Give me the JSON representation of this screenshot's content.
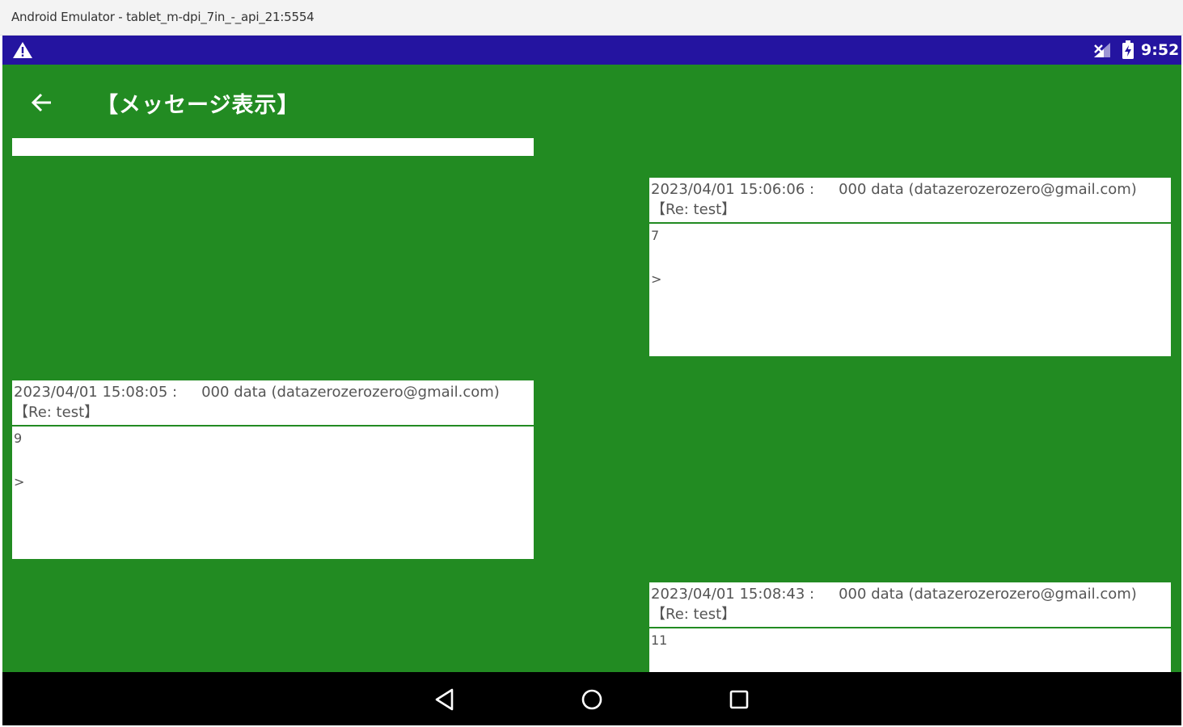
{
  "window": {
    "title": "Android Emulator - tablet_m-dpi_7in_-_api_21:5554"
  },
  "status_bar": {
    "time": "9:52",
    "background": "#2414a0"
  },
  "app_bar": {
    "title": "【メッセージ表示】",
    "background": "#228b22"
  },
  "search": {
    "value": "",
    "placeholder": ""
  },
  "messages": [
    {
      "timestamp": "2023/04/01 15:06:06 :",
      "sender": "000 data (datazerozerozero@gmail.com)",
      "subject": "【Re: test】",
      "body": "7",
      "quote": ">"
    },
    {
      "timestamp": "2023/04/01 15:08:05 :",
      "sender": "000 data (datazerozerozero@gmail.com)",
      "subject": "【Re: test】",
      "body": "9",
      "quote": ">"
    },
    {
      "timestamp": "2023/04/01 15:08:43 :",
      "sender": "000 data (datazerozerozero@gmail.com)",
      "subject": "【Re: test】",
      "body": "11",
      "quote": ""
    }
  ]
}
